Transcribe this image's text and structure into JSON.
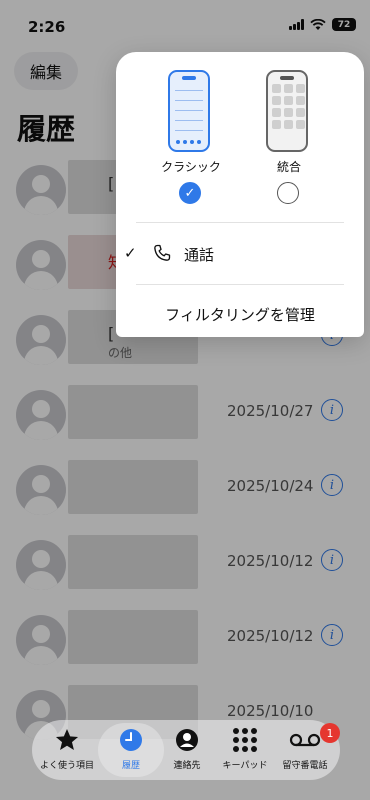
{
  "status": {
    "time": "2:26",
    "battery": "72"
  },
  "header": {
    "edit_label": "編集",
    "title": "履歴"
  },
  "calls": [
    {
      "name": "[",
      "sub": "",
      "date": "",
      "red": false
    },
    {
      "name": "知",
      "sub": "",
      "date": "",
      "red": true
    },
    {
      "name": "[",
      "sub": "の他",
      "date": "",
      "red": false
    },
    {
      "name": "",
      "sub": "",
      "date": "2025/10/27",
      "red": false
    },
    {
      "name": "",
      "sub": "",
      "date": "2025/10/24",
      "red": false
    },
    {
      "name": "",
      "sub": "",
      "date": "2025/10/12",
      "red": false
    },
    {
      "name": "",
      "sub": "",
      "date": "2025/10/12",
      "red": false
    },
    {
      "name": "",
      "sub": "",
      "date": "2025/10/10",
      "red": false
    }
  ],
  "popover": {
    "classic_label": "クラシック",
    "merged_label": "統合",
    "calls_label": "通話",
    "filter_label": "フィルタリングを管理",
    "selected_layout": "classic"
  },
  "tabs": {
    "favorites": "よく使う項目",
    "recents": "履歴",
    "contacts": "連絡先",
    "keypad": "キーパッド",
    "voicemail": "留守番電話",
    "voicemail_badge": "1",
    "active": "recents"
  },
  "colors": {
    "accent": "#2f79e8",
    "badge": "#e5362f",
    "missed": "#d32020"
  }
}
